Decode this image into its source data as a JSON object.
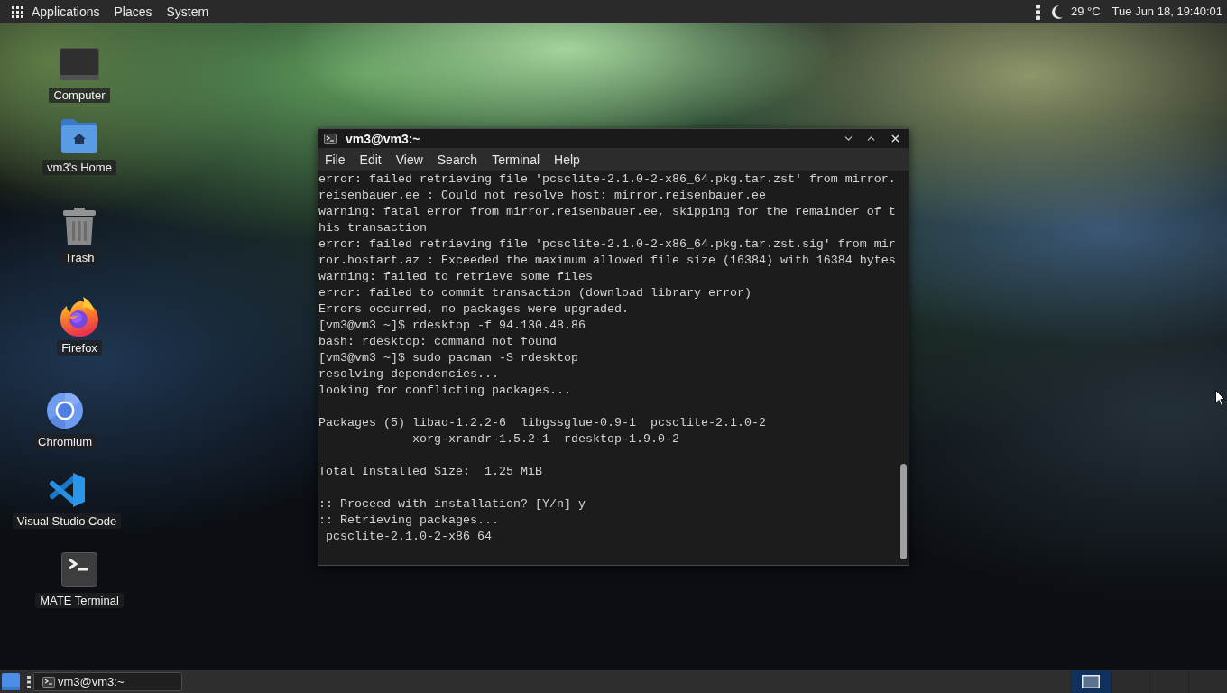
{
  "top_panel": {
    "menus": [
      {
        "label": "Applications"
      },
      {
        "label": "Places"
      },
      {
        "label": "System"
      }
    ],
    "temperature": "29 °C",
    "clock": "Tue Jun 18, 19:40:01"
  },
  "desktop_icons": [
    {
      "label": "Computer",
      "kind": "computer"
    },
    {
      "label": "vm3's Home",
      "kind": "home"
    },
    {
      "label": "Trash",
      "kind": "trash"
    },
    {
      "label": "Firefox",
      "kind": "fox"
    },
    {
      "label": "Chromium",
      "kind": "orb"
    },
    {
      "label": "Visual Studio Code",
      "kind": "ribbon"
    },
    {
      "label": "MATE Terminal",
      "kind": "terminal"
    }
  ],
  "terminal_window": {
    "title": "vm3@vm3:~",
    "menu": [
      "File",
      "Edit",
      "View",
      "Search",
      "Terminal",
      "Help"
    ],
    "output_blocks": [
      [
        "error: failed retrieving file 'pcsclite-2.1.0-2-x86_64.pkg.tar.zst' from mirror.",
        "reisenbauer.ee : Could not resolve host: mirror.reisenbauer.ee",
        "warning: fatal error from mirror.reisenbauer.ee, skipping for the remainder of t",
        "his transaction",
        "error: failed retrieving file 'pcsclite-2.1.0-2-x86_64.pkg.tar.zst.sig' from mir",
        "ror.hostart.az : Exceeded the maximum allowed file size (16384) with 16384 bytes",
        "warning: failed to retrieve some files",
        "error: failed to commit transaction (download library error)",
        "Errors occurred, no packages were upgraded.",
        "[vm3@vm3 ~]$ rdesktop -f 94.130.48.86",
        "bash: rdesktop: command not found",
        "[vm3@vm3 ~]$ sudo pacman -S rdesktop",
        "resolving dependencies...",
        "looking for conflicting packages..."
      ],
      [
        "Packages (5) libao-1.2.2-6  libgssglue-0.9-1  pcsclite-2.1.0-2",
        "             xorg-xrandr-1.5.2-1  rdesktop-1.9.0-2"
      ],
      [
        "Total Installed Size:  1.25 MiB"
      ],
      [
        ":: Proceed with installation? [Y/n] y",
        ":: Retrieving packages...",
        " pcsclite-2.1.0-2-x86_64"
      ]
    ]
  },
  "taskbar": {
    "windows": [
      {
        "title": "vm3@vm3:~"
      }
    ],
    "workspaces": [
      {
        "selected": true
      },
      {
        "selected": false
      },
      {
        "selected": false
      },
      {
        "selected": false
      }
    ]
  }
}
